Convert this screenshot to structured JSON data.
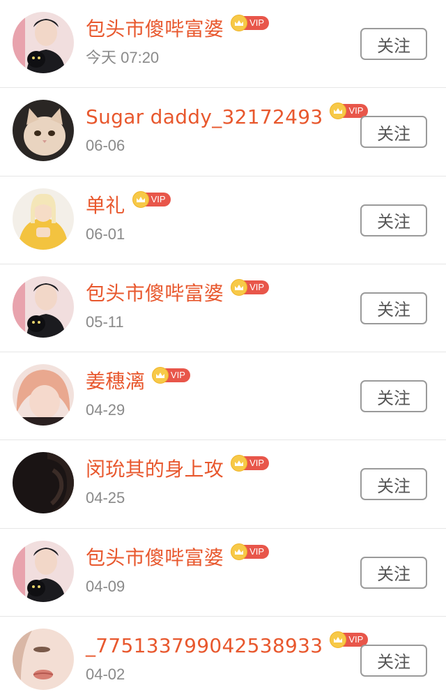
{
  "vip_label": "VIP",
  "follow_label": "关注",
  "items": [
    {
      "name": "包头市傻哔富婆",
      "time": "今天 07:20",
      "avatar": "boy-with-black-cat"
    },
    {
      "name": "Sugar daddy_32172493",
      "time": "06-06",
      "avatar": "cat"
    },
    {
      "name": "单礼",
      "time": "06-01",
      "avatar": "girl-yellow-hoodie"
    },
    {
      "name": "包头市傻哔富婆",
      "time": "05-11",
      "avatar": "boy-with-black-cat"
    },
    {
      "name": "姜穗漓",
      "time": "04-29",
      "avatar": "pink-hair-person"
    },
    {
      "name": "闵玧其的身上攻",
      "time": "04-25",
      "avatar": "dark-silhouette"
    },
    {
      "name": "包头市傻哔富婆",
      "time": "04-09",
      "avatar": "boy-with-black-cat"
    },
    {
      "name": "_775133799042538933",
      "time": "04-02",
      "avatar": "close-up-face"
    }
  ],
  "colors": {
    "name": "#e8582e",
    "time": "#8a8a8a",
    "vip_tag": "#e8564a",
    "crown": "#f7c948",
    "button_border": "#9a9a9a"
  }
}
